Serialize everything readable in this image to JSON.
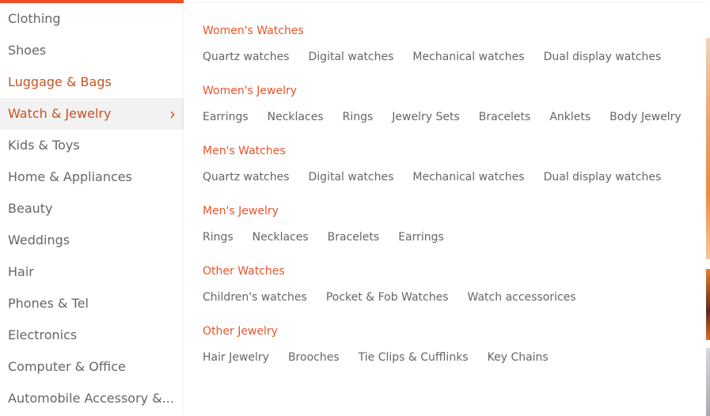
{
  "sidebar": {
    "categories": [
      {
        "label": "Clothing"
      },
      {
        "label": "Shoes"
      },
      {
        "label": "Luggage & Bags"
      },
      {
        "label": "Watch & Jewelry"
      },
      {
        "label": "Kids & Toys"
      },
      {
        "label": "Home & Appliances"
      },
      {
        "label": "Beauty"
      },
      {
        "label": "Weddings"
      },
      {
        "label": "Hair"
      },
      {
        "label": "Phones & Tel"
      },
      {
        "label": "Electronics"
      },
      {
        "label": "Computer & Office"
      },
      {
        "label": "Automobile Accessory &..."
      }
    ],
    "active_index": 3,
    "hover_index": 2,
    "arrow_icon": "chevron-right-icon"
  },
  "panel": {
    "groups": [
      {
        "title": "Women's Watches",
        "links": [
          "Quartz watches",
          "Digital watches",
          "Mechanical watches",
          "Dual display watches"
        ]
      },
      {
        "title": "Women's Jewelry",
        "links": [
          "Earrings",
          "Necklaces",
          "Rings",
          "Jewelry Sets",
          "Bracelets",
          "Anklets",
          "Body Jewelry"
        ]
      },
      {
        "title": "Men's Watches",
        "links": [
          "Quartz watches",
          "Digital watches",
          "Mechanical watches",
          "Dual display watches"
        ]
      },
      {
        "title": "Men's Jewelry",
        "links": [
          "Rings",
          "Necklaces",
          "Bracelets",
          "Earrings"
        ]
      },
      {
        "title": "Other Watches",
        "links": [
          "Children's watches",
          "Pocket & Fob Watches",
          "Watch accessorices"
        ]
      },
      {
        "title": "Other Jewelry",
        "links": [
          "Hair Jewelry",
          "Brooches",
          "Tie Clips & Cufflinks",
          "Key Chains"
        ]
      }
    ]
  },
  "colors": {
    "accent": "#f04e23",
    "group_title": "#e8542a",
    "active_text": "#c8521f",
    "text": "#666666",
    "active_bg": "#f2f2f2"
  }
}
